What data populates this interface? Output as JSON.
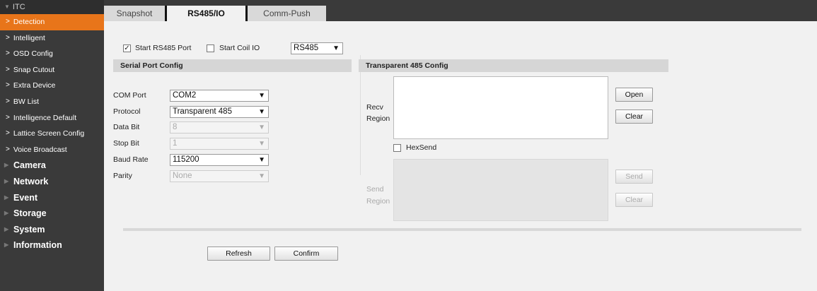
{
  "sidebar": {
    "header": "ITC",
    "sub_items": [
      {
        "label": "Detection",
        "active": true
      },
      {
        "label": "Intelligent"
      },
      {
        "label": "OSD Config"
      },
      {
        "label": "Snap Cutout"
      },
      {
        "label": "Extra Device"
      },
      {
        "label": "BW List"
      },
      {
        "label": "Intelligence Default"
      },
      {
        "label": "Lattice Screen Config"
      },
      {
        "label": "Voice Broadcast"
      }
    ],
    "main_items": [
      "Camera",
      "Network",
      "Event",
      "Storage",
      "System",
      "Information"
    ],
    "accent_color": "#e8751a"
  },
  "tabs": [
    "Snapshot",
    "RS485/IO",
    "Comm-Push"
  ],
  "active_tab": "RS485/IO",
  "options": {
    "start_rs485_label": "Start RS485 Port",
    "start_rs485_checked": true,
    "start_coil_label": "Start Coil IO",
    "start_coil_checked": false,
    "port_select": "RS485"
  },
  "serial": {
    "title": "Serial Port Config",
    "fields": [
      {
        "label": "COM Port",
        "value": "COM2",
        "disabled": false
      },
      {
        "label": "Protocol",
        "value": "Transparent 485",
        "disabled": false
      },
      {
        "label": "Data Bit",
        "value": "8",
        "disabled": true
      },
      {
        "label": "Stop Bit",
        "value": "1",
        "disabled": true
      },
      {
        "label": "Baud Rate",
        "value": "115200",
        "disabled": false
      },
      {
        "label": "Parity",
        "value": "None",
        "disabled": true
      }
    ]
  },
  "transparent": {
    "title": "Transparent 485 Config",
    "recv_label_1": "Recv",
    "recv_label_2": "Region",
    "open_label": "Open",
    "clear_label": "Clear",
    "hexsend_label": "HexSend",
    "send_label_1": "Send",
    "send_label_2": "Region",
    "send_button": "Send",
    "send_clear_button": "Clear"
  },
  "footer": {
    "refresh": "Refresh",
    "confirm": "Confirm"
  }
}
